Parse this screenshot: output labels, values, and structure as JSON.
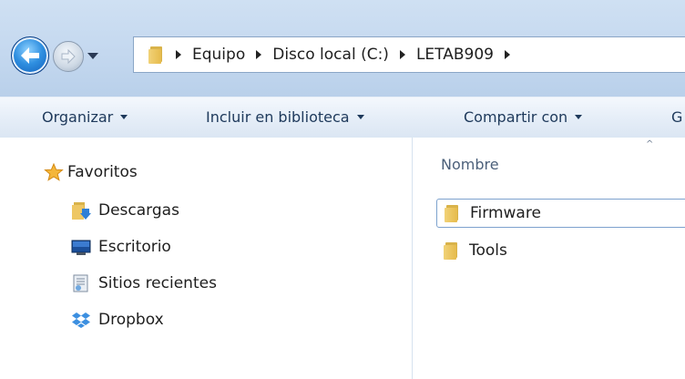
{
  "address_bar": {
    "breadcrumbs": [
      "Equipo",
      "Disco local (C:)",
      "LETAB909"
    ]
  },
  "toolbar": {
    "buttons": [
      "Organizar",
      "Incluir en biblioteca",
      "Compartir con",
      "G"
    ]
  },
  "nav_pane": {
    "favorites_label": "Favoritos",
    "items": [
      "Descargas",
      "Escritorio",
      "Sitios recientes",
      "Dropbox"
    ]
  },
  "content": {
    "column_header": "Nombre",
    "files": [
      {
        "name": "Firmware",
        "selected": true
      },
      {
        "name": "Tools",
        "selected": false
      }
    ]
  },
  "colors": {
    "chrome_blue": "#c4d8ef",
    "toolbar_text": "#1e395b",
    "folder_yellow": "#e6bb4c",
    "selection_border": "#7da2ce"
  }
}
